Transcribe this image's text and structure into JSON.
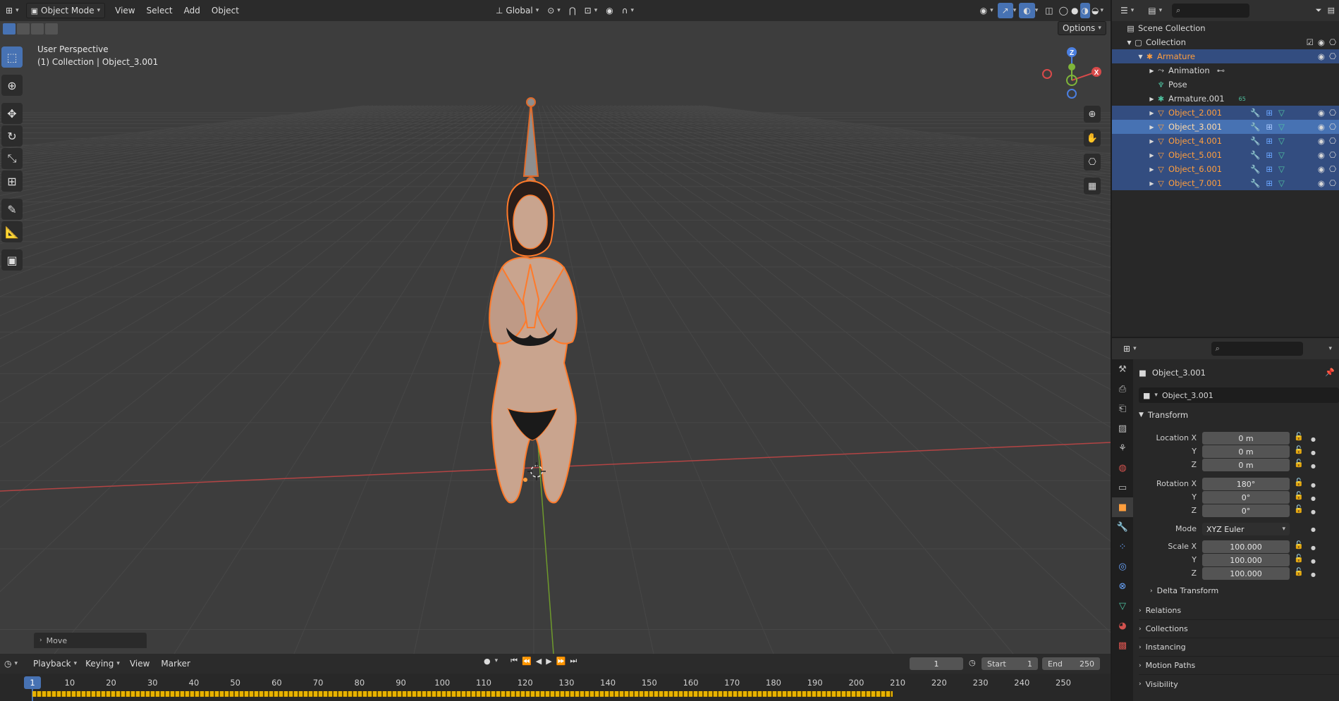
{
  "viewport": {
    "header": {
      "mode": "Object Mode",
      "menus": [
        "View",
        "Select",
        "Add",
        "Object"
      ],
      "orientation": "Global",
      "options_label": "Options"
    },
    "overlay_text": {
      "perspective": "User Perspective",
      "collection": "(1) Collection | Object_3.001"
    },
    "gizmo_axes": {
      "z": "Z",
      "x": "X"
    },
    "last_operator": "Move"
  },
  "outliner": {
    "search_placeholder": "",
    "rows": [
      {
        "name": "Scene Collection"
      },
      {
        "name": "Collection"
      },
      {
        "name": "Armature"
      },
      {
        "name": "Animation"
      },
      {
        "name": "Pose"
      },
      {
        "name": "Armature.001",
        "badge": "65"
      },
      {
        "name": "Object_2.001"
      },
      {
        "name": "Object_3.001"
      },
      {
        "name": "Object_4.001"
      },
      {
        "name": "Object_5.001"
      },
      {
        "name": "Object_6.001"
      },
      {
        "name": "Object_7.001"
      }
    ]
  },
  "properties": {
    "object_name": "Object_3.001",
    "object_datablock": "Object_3.001",
    "transform": {
      "title": "Transform",
      "location_label": "Location X",
      "location": [
        "0 m",
        "0 m",
        "0 m"
      ],
      "rotation_label": "Rotation X",
      "rotation": [
        "180°",
        "0°",
        "0°"
      ],
      "mode_label": "Mode",
      "mode": "XYZ Euler",
      "scale_label": "Scale X",
      "scale": [
        "100.000",
        "100.000",
        "100.000"
      ],
      "axis_y": "Y",
      "axis_z": "Z",
      "delta": "Delta Transform"
    },
    "panels": [
      "Relations",
      "Collections",
      "Instancing",
      "Motion Paths",
      "Visibility"
    ]
  },
  "timeline": {
    "menus": [
      "Playback",
      "Keying",
      "View",
      "Marker"
    ],
    "current_frame": "1",
    "start_label": "Start",
    "start": "1",
    "end_label": "End",
    "end": "250",
    "ruler": [
      "1",
      "10",
      "20",
      "30",
      "40",
      "50",
      "60",
      "70",
      "80",
      "90",
      "100",
      "110",
      "120",
      "130",
      "140",
      "150",
      "160",
      "170",
      "180",
      "190",
      "200",
      "210",
      "220",
      "230",
      "240",
      "250"
    ]
  },
  "colors": {
    "selection_orange": "#ff9e3d",
    "active_blue": "#4772b3",
    "x_axis": "#c84b4b",
    "y_axis": "#7aa52e"
  }
}
